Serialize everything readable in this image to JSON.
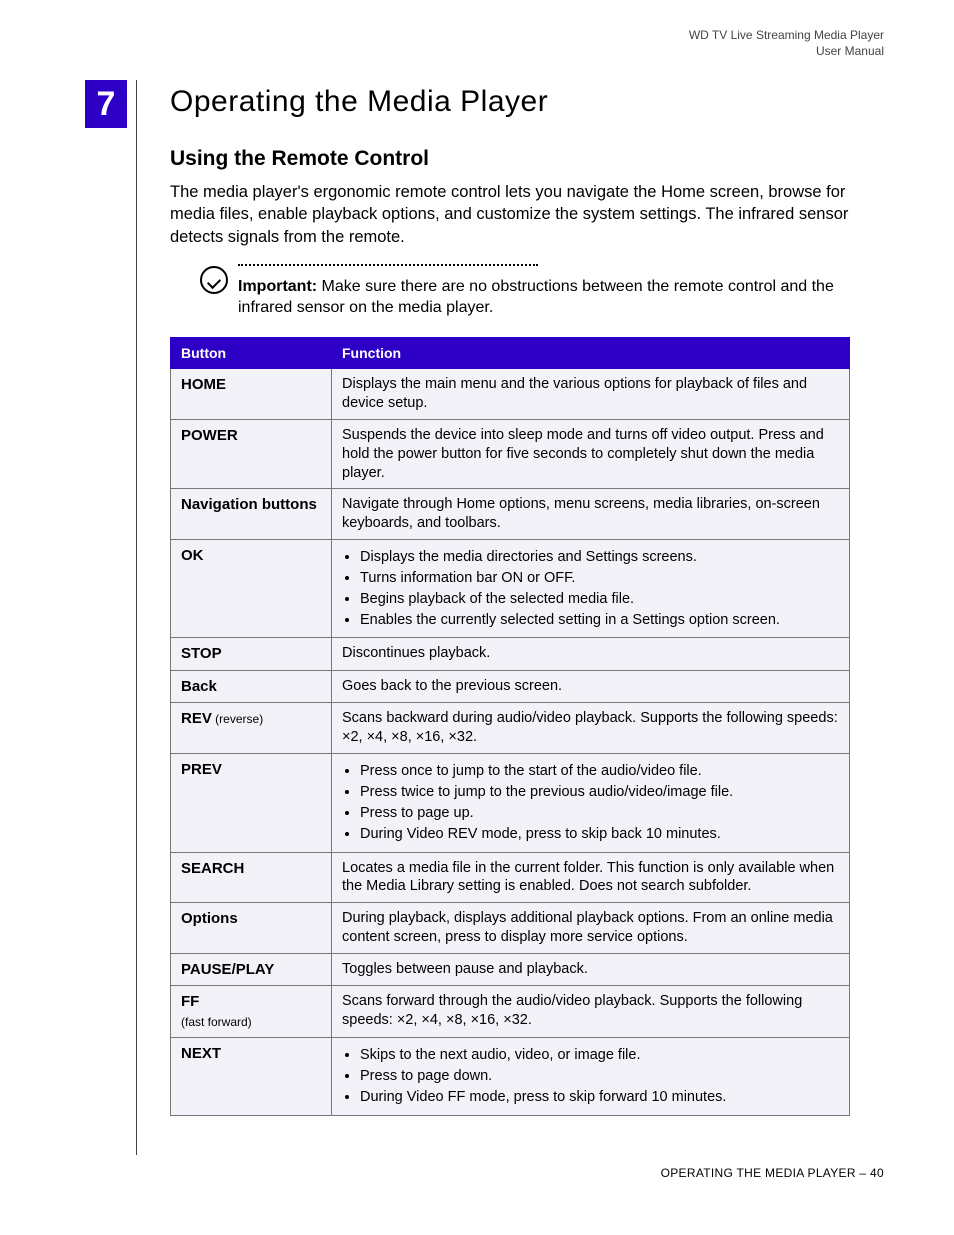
{
  "header": {
    "line1": "WD TV Live Streaming Media Player",
    "line2": "User Manual"
  },
  "chapter": {
    "number": "7",
    "title": "Operating the Media Player"
  },
  "section": {
    "title": "Using the Remote Control",
    "intro": "The media player's ergonomic remote control lets you navigate the Home screen, browse for media files, enable playback options, and customize the system settings. The infrared sensor detects signals from the remote."
  },
  "important": {
    "label": "Important:",
    "text": " Make sure there are no obstructions between the remote control and the infrared sensor on the media player."
  },
  "table": {
    "headers": {
      "button": "Button",
      "function": "Function"
    },
    "rows": [
      {
        "button": "HOME",
        "sub": "",
        "type": "text",
        "text": "Displays the main menu and the various options for playback of files and device setup."
      },
      {
        "button": "POWER",
        "sub": "",
        "type": "text",
        "text": "Suspends the device into sleep mode and turns off video output. Press and hold the power button for five seconds to completely shut down the media player."
      },
      {
        "button": "Navigation buttons",
        "sub": "",
        "type": "text",
        "text": "Navigate through Home options, menu screens, media libraries, on-screen keyboards, and toolbars."
      },
      {
        "button": "OK",
        "sub": "",
        "type": "list",
        "items": [
          "Displays the media directories and Settings screens.",
          "Turns information bar ON or OFF.",
          "Begins playback of the selected media file.",
          "Enables the currently selected setting in a Settings option screen."
        ]
      },
      {
        "button": "STOP",
        "sub": "",
        "type": "text",
        "text": "Discontinues playback."
      },
      {
        "button": "Back",
        "sub": "",
        "type": "text",
        "text": "Goes back to the previous screen."
      },
      {
        "button": "REV",
        "sub": " (reverse)",
        "type": "text",
        "text": "Scans backward during audio/video playback. Supports the following speeds: ×2, ×4, ×8, ×16, ×32."
      },
      {
        "button": "PREV",
        "sub": "",
        "type": "list",
        "items": [
          "Press once to jump to the start of the audio/video file.",
          "Press twice to jump to the previous audio/video/image file.",
          "Press to page up.",
          "During Video REV mode, press to skip back 10 minutes."
        ]
      },
      {
        "button": "SEARCH",
        "sub": "",
        "type": "text",
        "text": "Locates a media file in the current folder. This function is only available when the Media Library setting is enabled. Does not search subfolder."
      },
      {
        "button": "Options",
        "sub": "",
        "type": "text",
        "text": "During playback, displays additional playback options. From an online media content screen, press to display more service options."
      },
      {
        "button": "PAUSE/PLAY",
        "sub": "",
        "type": "text",
        "text": "Toggles between pause and playback."
      },
      {
        "button": "FF",
        "sub": "(fast forward)",
        "type": "text",
        "text": "Scans forward through the audio/video playback. Supports the following speeds: ×2, ×4, ×8, ×16, ×32."
      },
      {
        "button": "NEXT",
        "sub": "",
        "type": "list",
        "items": [
          "Skips to the next audio, video, or image file.",
          "Press to page down.",
          "During Video FF mode, press to skip forward 10 minutes."
        ]
      }
    ]
  },
  "footer": {
    "section": "OPERATING THE MEDIA PLAYER",
    "sep": " – ",
    "page": "40"
  }
}
